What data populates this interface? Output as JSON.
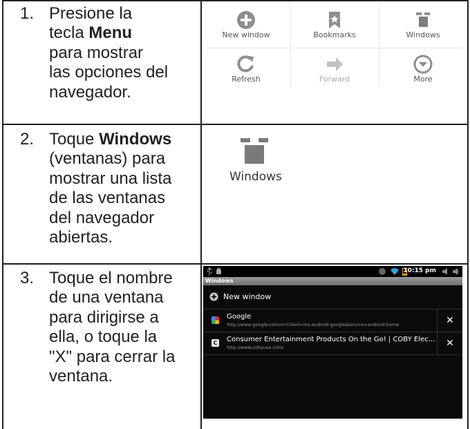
{
  "steps": [
    {
      "number": "1.",
      "lines": [
        {
          "before": "Presione la",
          "bold": "",
          "after": ""
        },
        {
          "before": "tecla ",
          "bold": "Menu",
          "after": ""
        },
        {
          "before": "para mostrar",
          "bold": "",
          "after": ""
        },
        {
          "before": "las opciones del",
          "bold": "",
          "after": ""
        },
        {
          "before": "navegador.",
          "bold": "",
          "after": ""
        }
      ],
      "menu_items": [
        {
          "label": "New window",
          "icon": "add-circle-icon"
        },
        {
          "label": "Bookmarks",
          "icon": "bookmark-icon"
        },
        {
          "label": "Windows",
          "icon": "windows-icon"
        },
        {
          "label": "Refresh",
          "icon": "refresh-icon"
        },
        {
          "label": "Forward",
          "icon": "forward-arrow-icon"
        },
        {
          "label": "More",
          "icon": "more-chevron-icon"
        }
      ]
    },
    {
      "number": "2.",
      "lines": [
        {
          "before": "Toque ",
          "bold": "Windows",
          "after": ""
        },
        {
          "before": "(ventanas) para",
          "bold": "",
          "after": ""
        },
        {
          "before": "mostrar una lista",
          "bold": "",
          "after": ""
        },
        {
          "before": "de las ventanas",
          "bold": "",
          "after": ""
        },
        {
          "before": "del navegador",
          "bold": "",
          "after": ""
        },
        {
          "before": "abiertas.",
          "bold": "",
          "after": ""
        }
      ],
      "icon_label": "Windows"
    },
    {
      "number": "3.",
      "lines": [
        {
          "before": "Toque el nombre",
          "bold": "",
          "after": ""
        },
        {
          "before": "de una ventana",
          "bold": "",
          "after": ""
        },
        {
          "before": "para dirigirse a",
          "bold": "",
          "after": ""
        },
        {
          "before": "ella, o toque la",
          "bold": "",
          "after": ""
        },
        {
          "before": "\"X\" para cerrar la",
          "bold": "",
          "after": ""
        },
        {
          "before": "ventana.",
          "bold": "",
          "after": ""
        }
      ],
      "screen": {
        "time": "10:15 pm",
        "title": "Windows",
        "new_window_label": "New window",
        "tabs": [
          {
            "title": "Google",
            "url": "http://www.google.com/m?client=ms-android-google&source=android-home",
            "close": "✕"
          },
          {
            "title": "Consumer Entertainment Products On the Go! | COBY Elec...",
            "url": "http://www.cobyusa.com/",
            "close": "✕"
          }
        ]
      }
    }
  ]
}
